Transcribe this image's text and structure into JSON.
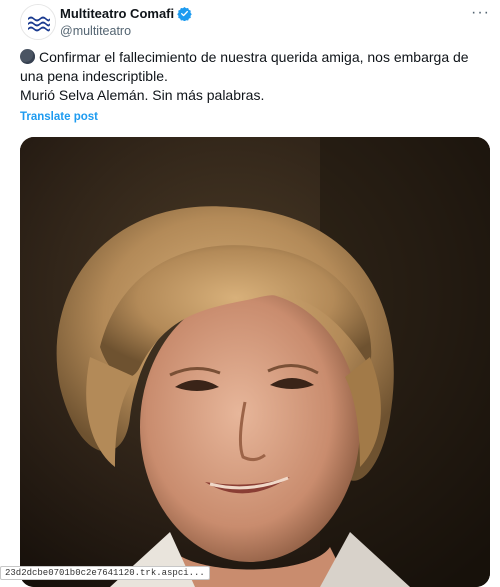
{
  "post": {
    "display_name": "Multiteatro Comafi",
    "handle": "@multiteatro",
    "verified": true,
    "more_icon": "more-icon",
    "text_line1": "Confirmar el fallecimiento de nuestra querida amiga, nos embarga de una pena indescriptible.",
    "text_line2": "Murió Selva Alemán. Sin más palabras.",
    "translate_label": "Translate post",
    "accent_color": "#1d9bf0"
  },
  "overlay": {
    "file_label": "23d2dcbe0701b0c2e7641120.trk.aspci..."
  }
}
